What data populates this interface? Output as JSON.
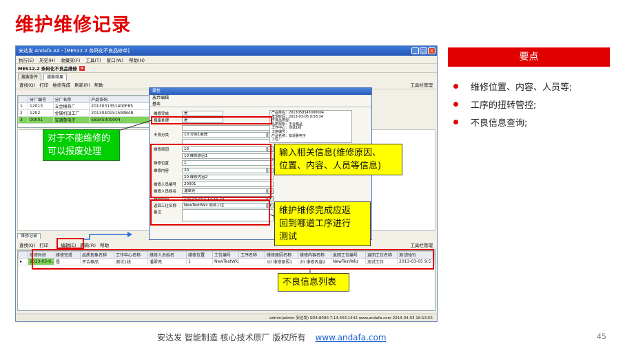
{
  "slide": {
    "title": "维护维修记录",
    "key_points_header": "要点",
    "key_points": [
      "维修位置、内容、人员等;",
      "工序的扭转管控;",
      "不良信息查询;"
    ],
    "footer_text": "安达发   智能制造 核心技术原厂   版权所有",
    "footer_link": "www.andafa.com",
    "page_number": "45"
  },
  "app": {
    "window_title": "安达发 Andafa AX - [MES12.2 务码化不良品修单]",
    "menu": [
      "执行(E)",
      "历史(H)",
      "收藏夹(F)",
      "工具(T)",
      "窗口(W)",
      "帮助(H)"
    ],
    "module_tab": "MES12.2 条码化不良品维修",
    "subtabs": [
      "搜索条件",
      "搜索结果"
    ],
    "toolbar_top": [
      "查找(Q)",
      "打印",
      "维修完成",
      "刷新(R)",
      "帮助"
    ],
    "toolbar_right": "工具栏管理",
    "top_table": {
      "headers": [
        "",
        "分厂编号",
        "分厂名称",
        "产品条码"
      ],
      "rows": [
        [
          "1",
          "12013",
          "五金模具厂",
          "2013031351400F85"
        ],
        [
          "2",
          "1202",
          "金属机加工厂",
          "2013040151599848"
        ],
        [
          "3",
          "00001",
          "安遇鲁电子",
          "5B345000004"
        ]
      ]
    },
    "bottom_tab": "维修记录",
    "toolbar_bottom": [
      "查找(Q)",
      "打印",
      "编辑(E)",
      "刷新(R)",
      "帮助"
    ],
    "bottom_table": {
      "headers": [
        "维修时间",
        "维修完成",
        "品质现象名称",
        "工作中心名称",
        "维修人员姓名",
        "维修位置",
        "工位编号",
        "工序名称",
        "维修原因名称",
        "维修内容名称",
        "返回工位编号",
        "返回工位名称",
        "测试时间"
      ],
      "rows": [
        [
          "2013-03-0..",
          "是",
          "不合格品",
          "测试1线",
          "潘翠亮",
          "1",
          "NewTestWkz",
          "",
          "10 维修原因1",
          "20 维修内容2",
          "NewTestWkz",
          "测试工位",
          "2013-03-05 9:5"
        ]
      ]
    },
    "status_bar": "admin(admin 安达发)  SD4:8090  7.14.403.1442  www.andafa.com  2013-04-03 16:13:55"
  },
  "dialog": {
    "title": "属性",
    "toolbar": "放弃编辑",
    "tab": "基本",
    "fields": [
      {
        "label": "维修完成",
        "value": "是"
      },
      {
        "label": "报废处理",
        "value": "是"
      },
      {
        "label": "",
        "value": ""
      },
      {
        "label": "不良分类",
        "value": "10 分类1离焊"
      },
      {
        "label": "",
        "value": ""
      },
      {
        "label": "维修原因",
        "value": "10"
      },
      {
        "label": "",
        "value": "10 维修原因1"
      },
      {
        "label": "维修位置",
        "value": "1"
      },
      {
        "label": "维修内容",
        "value": "20"
      },
      {
        "label": "",
        "value": "20 维修内容2"
      },
      {
        "label": "维修人员编号",
        "value": "20001"
      },
      {
        "label": "维修人员姓名",
        "value": "潘翠亮"
      },
      {
        "label": "维修时间",
        "value": "2013-03-05 15:12:35"
      },
      {
        "label": "返回工位名称",
        "value": "NewTestWkz 测试工位"
      },
      {
        "label": "备注",
        "value": ""
      }
    ],
    "info_lines": [
      "产品条码：2013058345000004",
      "发现时间：2013-03-05 9:58:34",
      "不良品类型：",
      "品质现象：不合格品",
      "工作中心：测试1线",
      "工序编号：",
      "产品名称：安适鲁电子",
      "工位："
    ]
  },
  "callouts": {
    "scrap": "对于不能维修的\n可以报废处理",
    "input": "输入相关信息(维修原因、\n位置、内容、人员等信息)",
    "return": "维护维修完成应返\n回到哪道工序进行\n测试",
    "list": "不良信息列表"
  },
  "colors": {
    "accent": "#e00000",
    "callout_yellow": "#ffff00",
    "callout_green": "#00d000",
    "selection": "#7fd35a"
  }
}
